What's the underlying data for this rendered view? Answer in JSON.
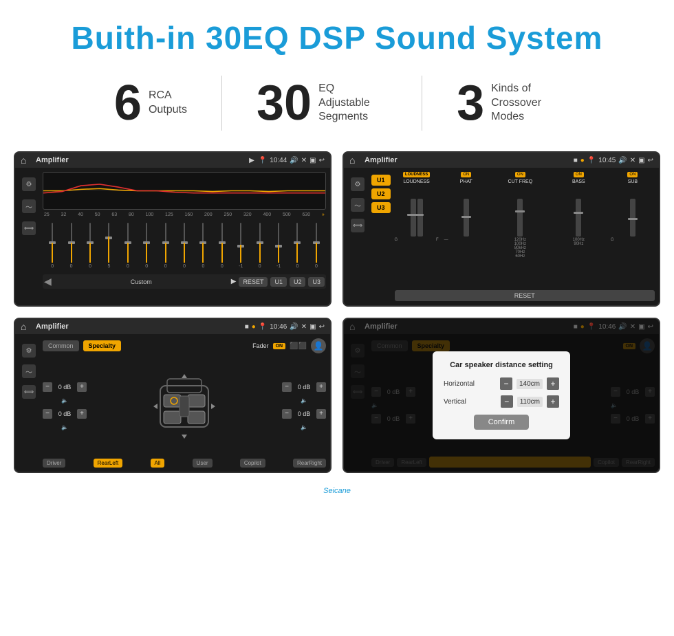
{
  "header": {
    "title": "Buith-in 30EQ DSP Sound System"
  },
  "stats": [
    {
      "number": "6",
      "label": "RCA\nOutputs"
    },
    {
      "number": "30",
      "label": "EQ Adjustable\nSegments"
    },
    {
      "number": "3",
      "label": "Kinds of\nCrossover Modes"
    }
  ],
  "screen1": {
    "status": {
      "title": "Amplifier",
      "time": "10:44"
    },
    "eq_bands": [
      "25",
      "32",
      "40",
      "50",
      "63",
      "80",
      "100",
      "125",
      "160",
      "200",
      "250",
      "320",
      "400",
      "500",
      "630"
    ],
    "eq_values": [
      "0",
      "0",
      "0",
      "5",
      "0",
      "0",
      "0",
      "0",
      "0",
      "0",
      "-1",
      "0",
      "-1",
      "0",
      "0"
    ],
    "controls": {
      "preset_label": "Custom",
      "reset": "RESET",
      "u1": "U1",
      "u2": "U2",
      "u3": "U3"
    }
  },
  "screen2": {
    "status": {
      "title": "Amplifier",
      "time": "10:45"
    },
    "presets": [
      "U1",
      "U2",
      "U3"
    ],
    "knobs": [
      {
        "label": "LOUDNESS",
        "on": true
      },
      {
        "label": "PHAT",
        "on": true
      },
      {
        "label": "CUT FREQ",
        "on": true
      },
      {
        "label": "BASS",
        "on": true
      },
      {
        "label": "SUB",
        "on": true
      }
    ],
    "reset": "RESET"
  },
  "screen3": {
    "status": {
      "title": "Amplifier",
      "time": "10:46"
    },
    "tabs": [
      "Common",
      "Specialty"
    ],
    "fader_label": "Fader",
    "on_text": "ON",
    "zones": {
      "driver": "Driver",
      "rear_left": "RearLeft",
      "all": "All",
      "user": "User",
      "copilot": "Copilot",
      "rear_right": "RearRight"
    },
    "speaker_values": {
      "top_left": "0 dB",
      "top_right": "0 dB",
      "bottom_left": "0 dB",
      "bottom_right": "0 dB"
    }
  },
  "screen4": {
    "status": {
      "title": "Amplifier",
      "time": "10:46"
    },
    "tabs": [
      "Common",
      "Specialty"
    ],
    "on_text": "ON",
    "zones": {
      "driver": "Driver",
      "rear_left": "RearLeft",
      "copilot": "Copilot",
      "rear_right": "RearRight"
    },
    "modal": {
      "title": "Car speaker distance setting",
      "horizontal_label": "Horizontal",
      "horizontal_value": "140cm",
      "vertical_label": "Vertical",
      "vertical_value": "110cm",
      "confirm": "Confirm"
    },
    "speaker_values": {
      "top_right": "0 dB",
      "bottom_right": "0 dB"
    }
  },
  "watermark": "Seicane"
}
